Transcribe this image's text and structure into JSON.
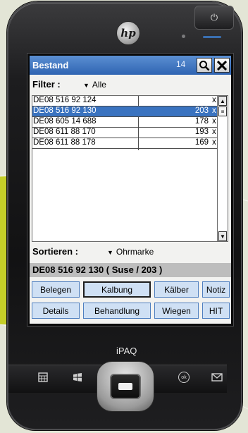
{
  "device": {
    "brand": "iPAQ",
    "logo": "hp",
    "power_symbol": "⏻"
  },
  "titlebar": {
    "title": "Bestand",
    "count": "14"
  },
  "filter": {
    "label": "Filter :",
    "value": "Alle"
  },
  "list": {
    "rows": [
      {
        "tag": "DE08 516 92 124",
        "number": "",
        "mark": "x"
      },
      {
        "tag": "DE08 516 92 130",
        "number": "203",
        "mark": "x"
      },
      {
        "tag": "DE08 605 14 688",
        "number": "178",
        "mark": "x"
      },
      {
        "tag": "DE08 611 88 170",
        "number": "193",
        "mark": "x"
      },
      {
        "tag": "DE08 611 88 178",
        "number": "169",
        "mark": "x"
      }
    ],
    "selected_index": 1
  },
  "sort": {
    "label": "Sortieren :",
    "value": "Ohrmarke"
  },
  "detail": {
    "text": "DE08 516 92 130 ( Suse / 203 )"
  },
  "buttons": {
    "row1": [
      "Belegen",
      "Kalbung",
      "Kälber",
      "Notiz"
    ],
    "row2": [
      "Details",
      "Behandlung",
      "Wiegen",
      "HIT"
    ]
  },
  "keys": {
    "ok": "ok"
  },
  "colors": {
    "titlebar": "#2f64b2",
    "selection": "#3a73c0",
    "button_fill": "#cfe0f4",
    "lime_accent": "#c5cf28"
  }
}
